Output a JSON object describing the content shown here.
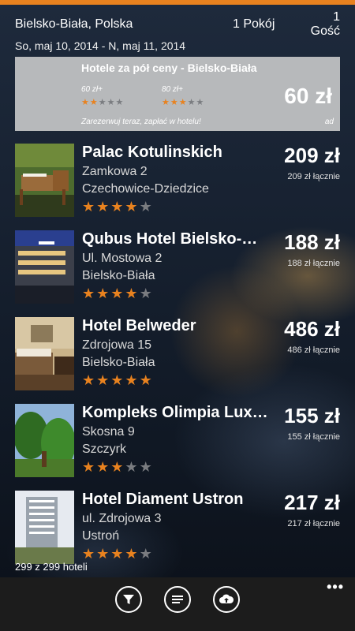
{
  "header": {
    "location": "Bielsko-Biała, Polska",
    "rooms": "1 Pokój",
    "guests": "1 Gość",
    "dates": "So, maj 10, 2014 - N, maj 11, 2014"
  },
  "ad": {
    "title": "Hotele za pół ceny - Bielsko-Biała",
    "options": [
      {
        "label": "60 zł+",
        "rating": 2
      },
      {
        "label": "80 zł+",
        "rating": 3
      }
    ],
    "price": "60 zł",
    "footer": "Zarezerwuj teraz, zapłać w hotelu!",
    "tag": "ad"
  },
  "hotels": [
    {
      "name": "Palac Kotulinskich",
      "street": "Zamkowa 2",
      "city": "Czechowice-Dziedzice",
      "rating": 4,
      "price": "209 zł",
      "total": "209 zł łącznie",
      "photo": "garden-terrace"
    },
    {
      "name": "Qubus Hotel Bielsko-…",
      "street": "Ul. Mostowa 2",
      "city": "Bielsko-Biała",
      "rating": 4,
      "price": "188 zł",
      "total": "188 zł łącznie",
      "photo": "modern-building-night"
    },
    {
      "name": "Hotel Belweder",
      "street": "Zdrojowa 15",
      "city": "Bielsko-Biała",
      "rating": 5,
      "price": "486 zł",
      "total": "486 zł łącznie",
      "photo": "hotel-room"
    },
    {
      "name": "Kompleks Olimpia Lux…",
      "street": "Skosna 9",
      "city": "Szczyrk",
      "rating": 3,
      "price": "155 zł",
      "total": "155 zł łącznie",
      "photo": "green-trees"
    },
    {
      "name": "Hotel Diament Ustron",
      "street": "ul. Zdrojowa 3",
      "city": "Ustroń",
      "rating": 4,
      "price": "217 zł",
      "total": "217 zł łącznie",
      "photo": "tall-building"
    }
  ],
  "results_count": "299 z 299 hoteli",
  "appbar": {
    "buttons": [
      "filter-icon",
      "sort-list-icon",
      "cloud-upload-icon"
    ],
    "more": "•••"
  },
  "colors": {
    "accent": "#e8821f",
    "ad_background": "#b7b9bb",
    "appbar": "#1c1c1c"
  }
}
